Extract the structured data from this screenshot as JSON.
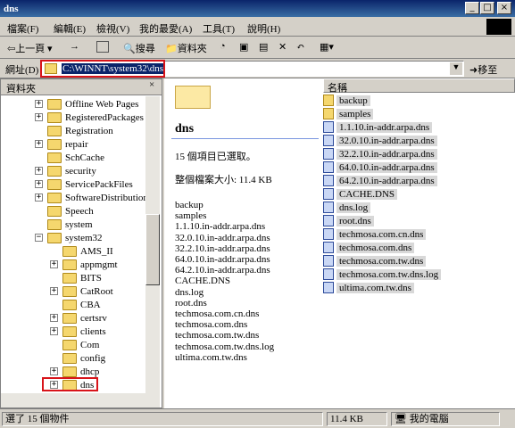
{
  "window": {
    "title": "dns",
    "min": "_",
    "max": "□",
    "close": "×"
  },
  "menu": [
    "檔案(F)",
    "編輯(E)",
    "檢視(V)",
    "我的最愛(A)",
    "工具(T)",
    "說明(H)"
  ],
  "toolbar": {
    "back": "上一頁",
    "forward": "→",
    "search": "搜尋",
    "folders": "資料夾"
  },
  "address": {
    "label": "網址(D)",
    "value": "C:\\WINNT\\system32\\dns",
    "go": "移至"
  },
  "folders": {
    "header": "資料夾",
    "items": [
      {
        "label": "Offline Web Pages",
        "expand": "+",
        "indent": 0
      },
      {
        "label": "RegisteredPackages",
        "expand": "+",
        "indent": 0
      },
      {
        "label": "Registration",
        "expand": "",
        "indent": 0
      },
      {
        "label": "repair",
        "expand": "+",
        "indent": 0
      },
      {
        "label": "SchCache",
        "expand": "",
        "indent": 0
      },
      {
        "label": "security",
        "expand": "+",
        "indent": 0
      },
      {
        "label": "ServicePackFiles",
        "expand": "+",
        "indent": 0
      },
      {
        "label": "SoftwareDistribution",
        "expand": "+",
        "indent": 0
      },
      {
        "label": "Speech",
        "expand": "",
        "indent": 0
      },
      {
        "label": "system",
        "expand": "",
        "indent": 0
      },
      {
        "label": "system32",
        "expand": "−",
        "indent": 0
      },
      {
        "label": "AMS_II",
        "expand": "",
        "indent": 1
      },
      {
        "label": "appmgmt",
        "expand": "+",
        "indent": 1
      },
      {
        "label": "BITS",
        "expand": "",
        "indent": 1
      },
      {
        "label": "CatRoot",
        "expand": "+",
        "indent": 1
      },
      {
        "label": "CBA",
        "expand": "",
        "indent": 1
      },
      {
        "label": "certsrv",
        "expand": "+",
        "indent": 1
      },
      {
        "label": "clients",
        "expand": "+",
        "indent": 1
      },
      {
        "label": "Com",
        "expand": "",
        "indent": 1
      },
      {
        "label": "config",
        "expand": "",
        "indent": 1
      },
      {
        "label": "dhcp",
        "expand": "+",
        "indent": 1
      },
      {
        "label": "dns",
        "expand": "+",
        "indent": 1
      }
    ]
  },
  "webview": {
    "title": "dns",
    "selected": "15 個項目已選取。",
    "size": "整個檔案大小: 11.4 KB",
    "files": [
      "backup",
      "samples",
      "1.1.10.in-addr.arpa.dns",
      "32.0.10.in-addr.arpa.dns",
      "32.2.10.in-addr.arpa.dns",
      "64.0.10.in-addr.arpa.dns",
      "64.2.10.in-addr.arpa.dns",
      "CACHE.DNS",
      "dns.log",
      "root.dns",
      "techmosa.com.cn.dns",
      "techmosa.com.dns",
      "techmosa.com.tw.dns",
      "techmosa.com.tw.dns.log",
      "ultima.com.tw.dns"
    ]
  },
  "list": {
    "header": "名稱",
    "items": [
      {
        "name": "backup",
        "type": "folder"
      },
      {
        "name": "samples",
        "type": "folder"
      },
      {
        "name": "1.1.10.in-addr.arpa.dns",
        "type": "file"
      },
      {
        "name": "32.0.10.in-addr.arpa.dns",
        "type": "file"
      },
      {
        "name": "32.2.10.in-addr.arpa.dns",
        "type": "file"
      },
      {
        "name": "64.0.10.in-addr.arpa.dns",
        "type": "file"
      },
      {
        "name": "64.2.10.in-addr.arpa.dns",
        "type": "file"
      },
      {
        "name": "CACHE.DNS",
        "type": "file"
      },
      {
        "name": "dns.log",
        "type": "file"
      },
      {
        "name": "root.dns",
        "type": "file"
      },
      {
        "name": "techmosa.com.cn.dns",
        "type": "file"
      },
      {
        "name": "techmosa.com.dns",
        "type": "file"
      },
      {
        "name": "techmosa.com.tw.dns",
        "type": "file"
      },
      {
        "name": "techmosa.com.tw.dns.log",
        "type": "file"
      },
      {
        "name": "ultima.com.tw.dns",
        "type": "file"
      }
    ]
  },
  "status": {
    "left": "選了 15 個物件",
    "size": "11.4 KB",
    "location": "我的電腦"
  }
}
